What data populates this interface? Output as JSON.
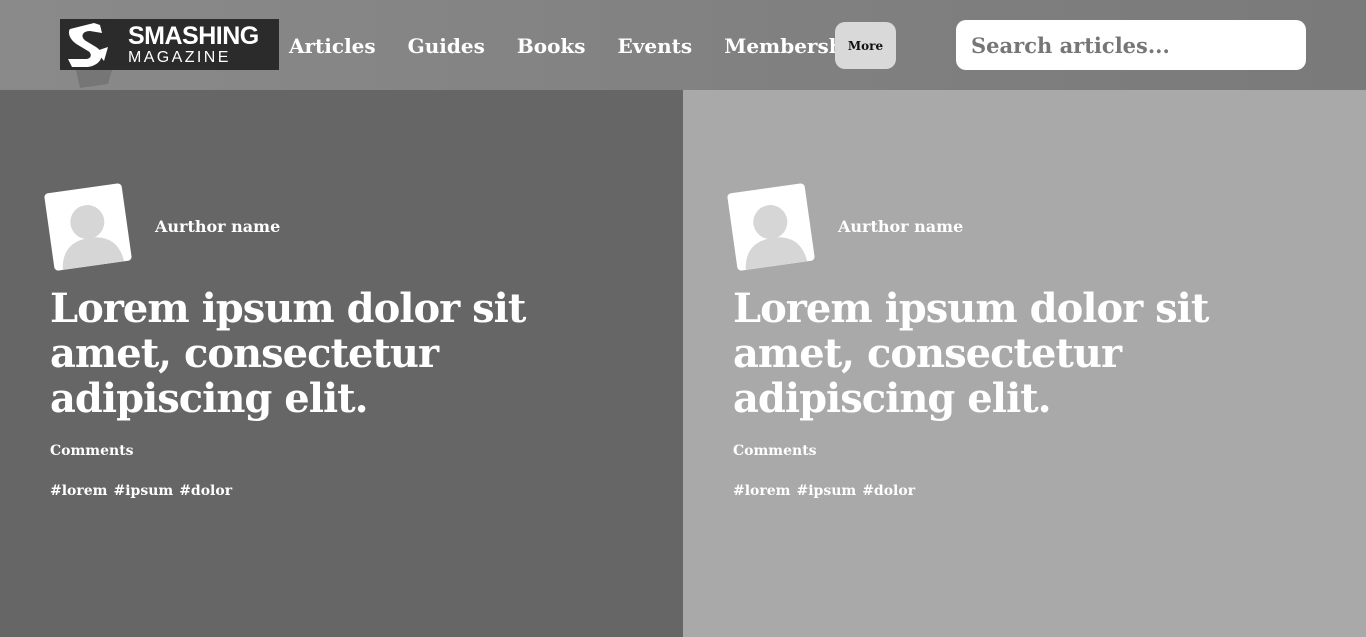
{
  "brand": {
    "logo_line1": "SMASHING",
    "logo_line2": "MAGAZINE"
  },
  "nav": {
    "items": [
      {
        "label": "Articles"
      },
      {
        "label": "Guides"
      },
      {
        "label": "Books"
      },
      {
        "label": "Events"
      },
      {
        "label": "Membership"
      }
    ],
    "more_label": "More"
  },
  "search": {
    "placeholder": "Search articles..."
  },
  "cards": [
    {
      "author": "Aurthor name",
      "title": "Lorem ipsum dolor sit amet, consectetur adipiscing elit.",
      "comments": "Comments",
      "tags": [
        "#lorem",
        "#ipsum",
        "#dolor"
      ]
    },
    {
      "author": "Aurthor name",
      "title": "Lorem ipsum dolor sit amet, consectetur adipiscing elit.",
      "comments": "Comments",
      "tags": [
        "#lorem",
        "#ipsum",
        "#dolor"
      ]
    }
  ],
  "colors": {
    "header_bg": "#808080",
    "card1_bg": "#666666",
    "card2_bg": "#a9a9a9",
    "more_button_bg": "#d9d9d9",
    "logo_bg": "#2b2b2b"
  },
  "icons": {
    "logo": "smashing-s-logo-icon",
    "avatar": "user-avatar-icon"
  }
}
